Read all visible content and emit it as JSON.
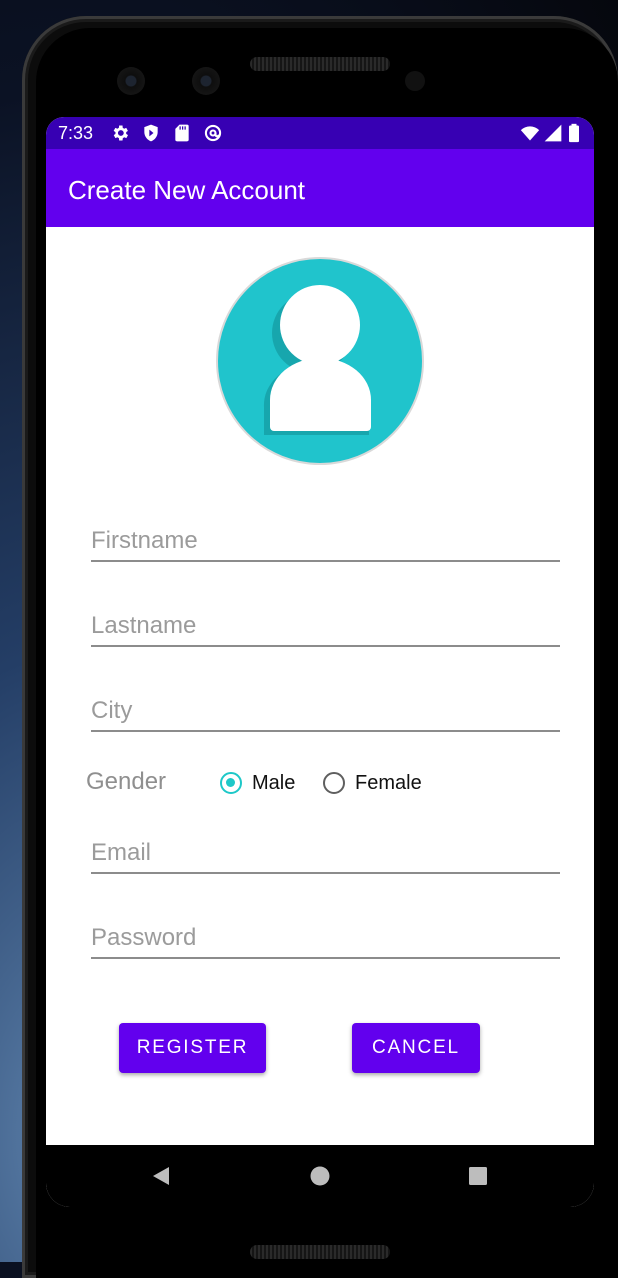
{
  "status_bar": {
    "time": "7:33",
    "icons": [
      "gear-icon",
      "shield-icon",
      "sd-card-icon",
      "at-sign-icon",
      "wifi-icon",
      "signal-icon",
      "battery-icon"
    ]
  },
  "app_bar": {
    "title": "Create New Account",
    "color": "#6200ee",
    "status_color": "#3700b3"
  },
  "avatar": {
    "icon": "user-avatar-icon",
    "color": "#20c4cc"
  },
  "form": {
    "firstname_placeholder": "Firstname",
    "lastname_placeholder": "Lastname",
    "city_placeholder": "City",
    "gender_label": "Gender",
    "gender_options": [
      {
        "label": "Male",
        "checked": true
      },
      {
        "label": "Female",
        "checked": false
      }
    ],
    "email_placeholder": "Email",
    "password_placeholder": "Password"
  },
  "buttons": {
    "register_label": "REGISTER",
    "cancel_label": "CANCEL"
  },
  "nav_bar": {
    "icons": [
      "back-icon",
      "home-icon",
      "recents-icon"
    ]
  }
}
